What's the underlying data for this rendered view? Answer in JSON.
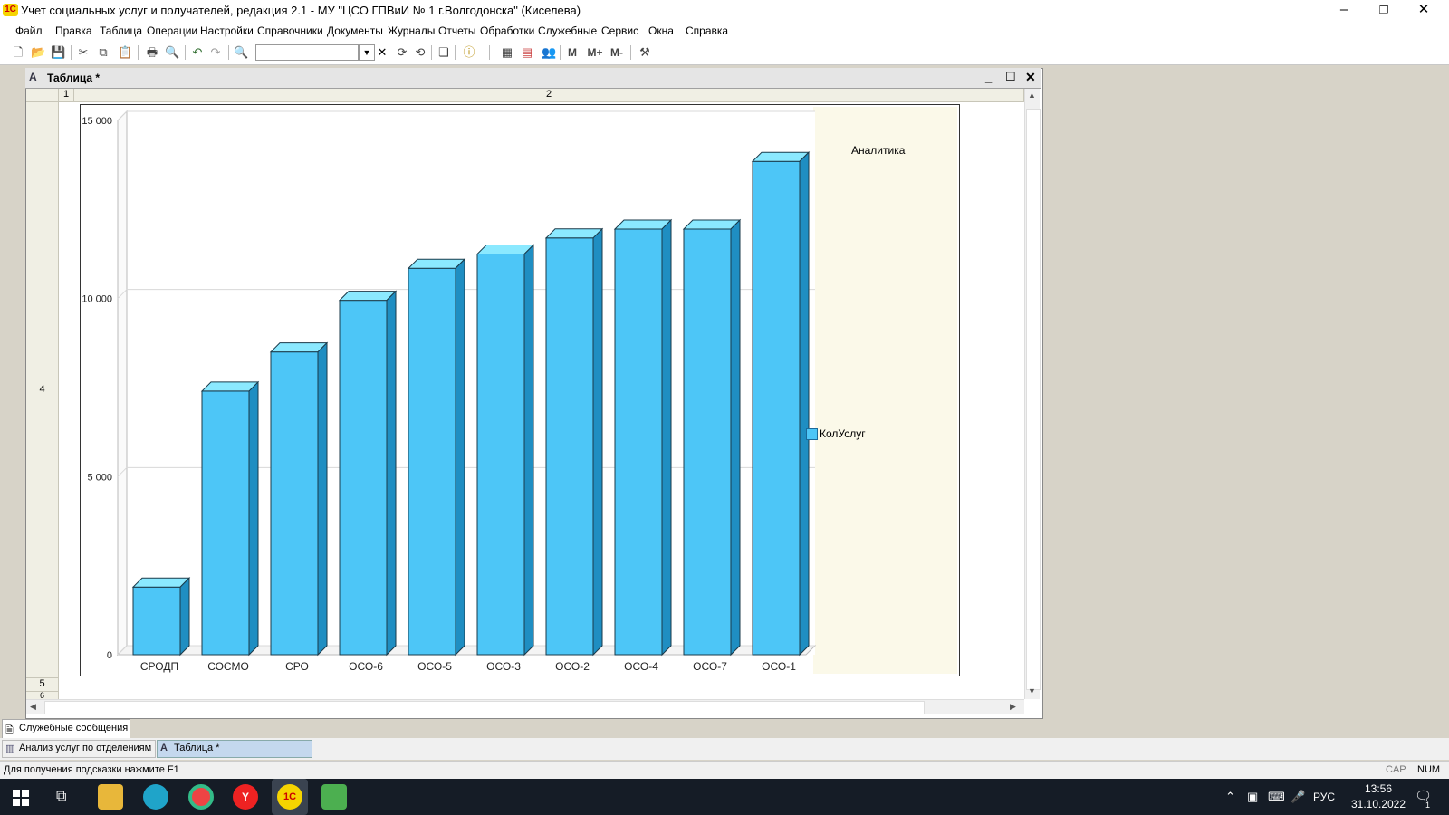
{
  "window": {
    "title": "Учет социальных услуг и получателей, редакция 2.1 - МУ \"ЦСО ГПВиИ № 1 г.Волгодонска\" (Киселева)",
    "logo_text": "1С"
  },
  "menu": [
    "Файл",
    "Правка",
    "Таблица",
    "Операции",
    "Настройки",
    "Справочники",
    "Документы",
    "Журналы",
    "Отчеты",
    "Обработки",
    "Служебные",
    "Сервис",
    "Окна",
    "Справка"
  ],
  "toolbar": {
    "m": "M",
    "mplus": "M+",
    "mminus": "M-"
  },
  "child_window": {
    "title": "Таблица *"
  },
  "sheet": {
    "col_headers": [
      "1",
      "2"
    ],
    "row_headers": [
      "4",
      "5",
      "6"
    ]
  },
  "chart_data": {
    "type": "bar",
    "title": "Аналитика",
    "categories": [
      "СРОДП",
      "СОСМО",
      "СРО",
      "ОСО-6",
      "ОСО-5",
      "ОСО-3",
      "ОСО-2",
      "ОСО-4",
      "ОСО-7",
      "ОСО-1"
    ],
    "series": [
      {
        "name": "КолУслуг",
        "values": [
          1900,
          7400,
          8500,
          9950,
          10850,
          11250,
          11700,
          11950,
          11950,
          13850
        ],
        "color": "#4dc6f7"
      }
    ],
    "yticks": [
      "15 000",
      "10 000",
      "5 000",
      "0"
    ],
    "ylim": [
      0,
      15000
    ],
    "grid": true,
    "legend": "right"
  },
  "tabs": {
    "service_messages": "Служебные сообщения",
    "window_tabs": [
      "Анализ услуг по отделениям",
      "Таблица *"
    ]
  },
  "status": {
    "hint": "Для получения подсказки нажмите F1",
    "cap": "CAP",
    "num": "NUM"
  },
  "taskbar": {
    "lang": "РУС",
    "time": "13:56",
    "date": "31.10.2022",
    "notif_count": "1"
  }
}
